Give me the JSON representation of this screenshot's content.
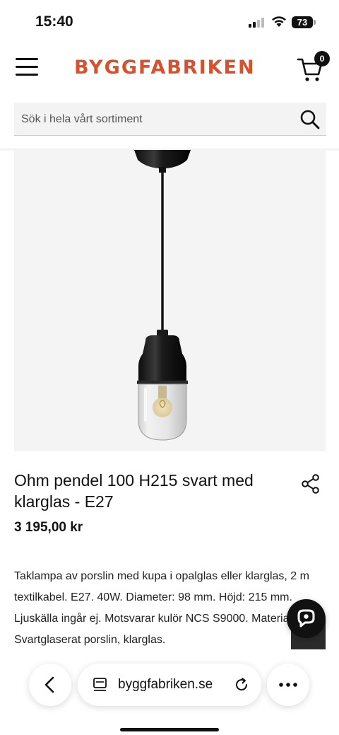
{
  "status_bar": {
    "time": "15:40",
    "battery": "73"
  },
  "header": {
    "logo": "BYGGFABRIKEN",
    "cart_count": "0"
  },
  "search": {
    "placeholder": "Sök i hela vårt sortiment"
  },
  "product": {
    "title": "Ohm pendel 100 H215 svart med klarglas - E27",
    "price": "3 195,00 kr",
    "description": "Taklampa av porslin med kupa i opalglas eller klarglas, 2 m textilkabel. E27. 40W. Diameter: 98 mm. Höjd: 215 mm. Ljuskälla ingår ej. Motsvarar kulör NCS S9000. Material: Svartglaserat porslin, klarglas."
  },
  "browser": {
    "url": "byggfabriken.se"
  },
  "colors": {
    "brand": "#d9512c",
    "text": "#111111"
  },
  "icons": {
    "menu": "hamburger-icon",
    "cart": "cart-icon",
    "search": "search-icon",
    "share": "share-icon",
    "chat": "chat-icon",
    "back": "chevron-left-icon",
    "reader": "reader-icon",
    "reload": "reload-icon",
    "more": "more-icon"
  }
}
